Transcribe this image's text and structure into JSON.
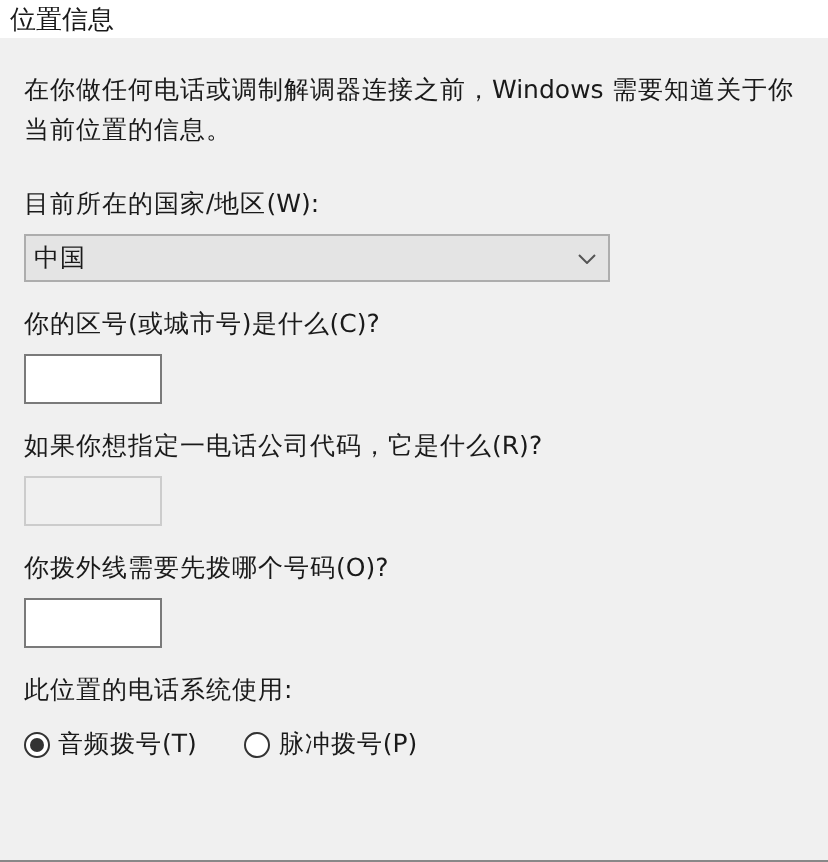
{
  "window": {
    "title": "位置信息"
  },
  "intro": "在你做任何电话或调制解调器连接之前，Windows 需要知道关于你当前位置的信息。",
  "fields": [
    {
      "kind": "dropdown",
      "label": "目前所在的国家/地区(W):",
      "value": "中国",
      "disabled": false
    },
    {
      "kind": "text",
      "label": "你的区号(或城市号)是什么(C)?",
      "disabled": false
    },
    {
      "kind": "text",
      "label": "如果你想指定一电话公司代码，它是什么(R)?",
      "disabled": true
    },
    {
      "kind": "text",
      "label": "你拨外线需要先拨哪个号码(O)?",
      "disabled": false
    }
  ],
  "dialing": {
    "label": "此位置的电话系统使用:",
    "options": [
      {
        "label": "音频拨号(T)",
        "selected": true
      },
      {
        "label": "脉冲拨号(P)",
        "selected": false
      }
    ]
  }
}
